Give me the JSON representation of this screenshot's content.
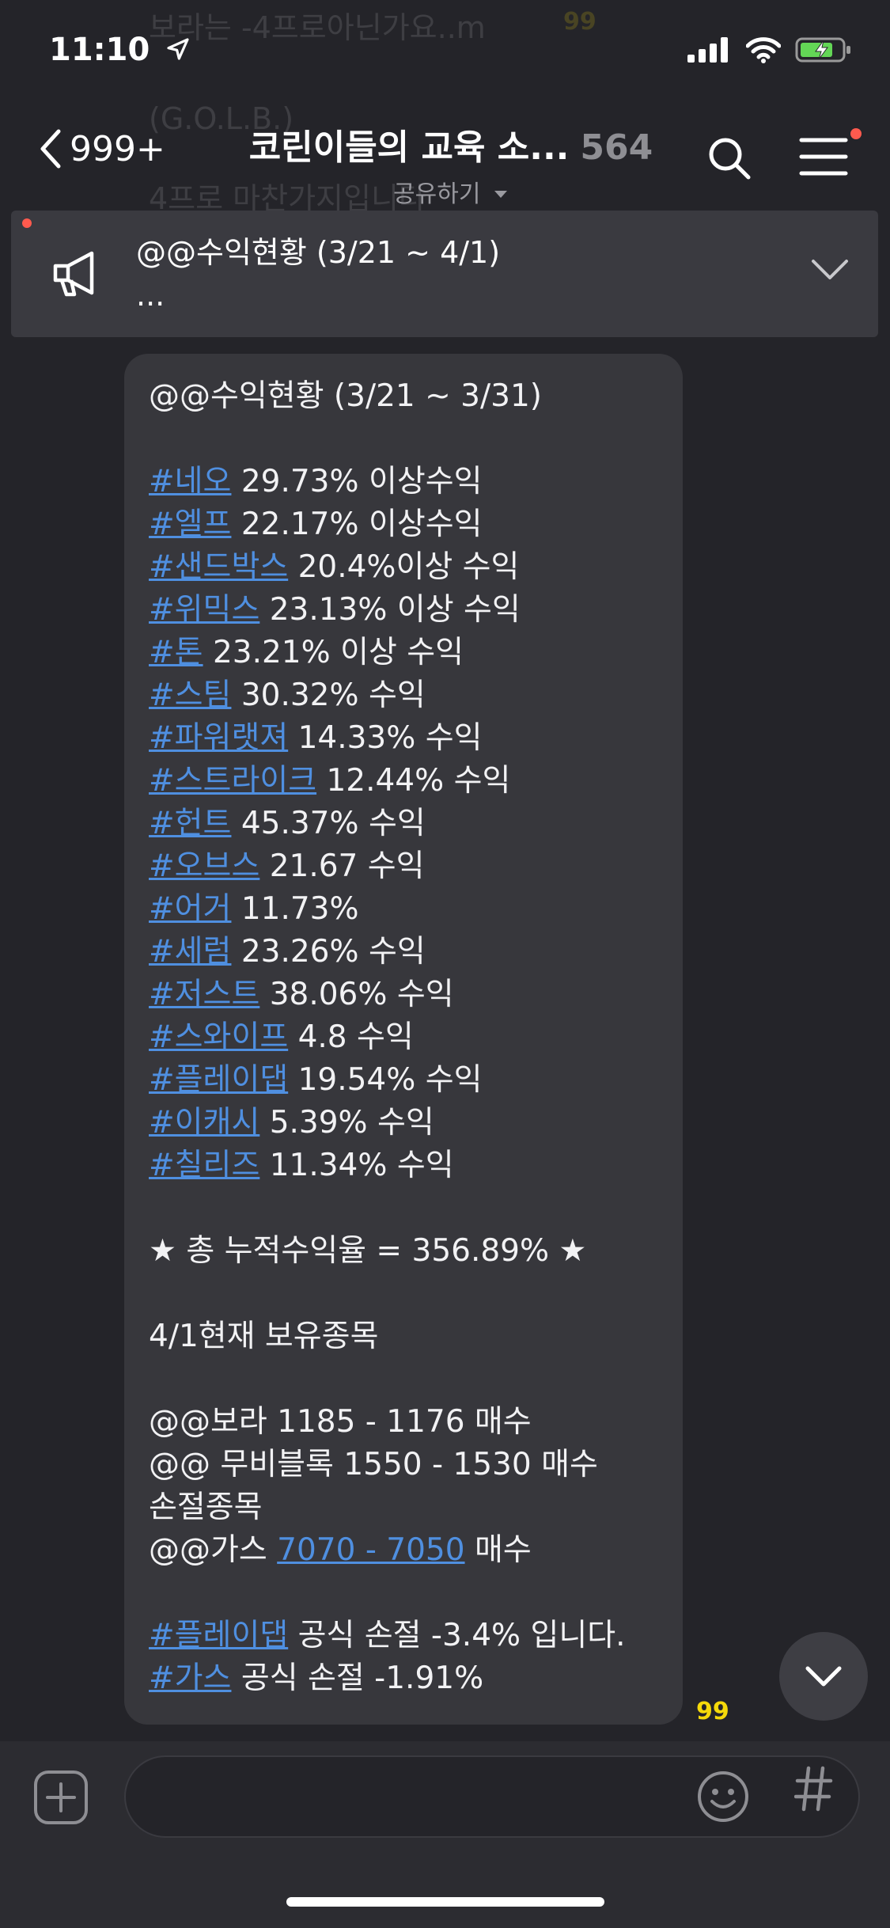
{
  "status_bar": {
    "time": "11:10"
  },
  "background_ghost": {
    "line1": "보라는 -4프로아닌가요..m",
    "line1_count": "99",
    "line2": "(G.O.L.B.)",
    "line3": "4프로 마찬가지입니다"
  },
  "header": {
    "back_count": "999+",
    "title": "코린이들의 교육 소...",
    "member_count": "564",
    "share_label": "공유하기"
  },
  "notice": {
    "title": "@@수익현황 (3/21 ~ 4/1)",
    "more": "..."
  },
  "message": {
    "header": "@@수익현황 (3/21 ~ 3/31)",
    "items": [
      {
        "tag": "#네오",
        "text": " 29.73% 이상수익"
      },
      {
        "tag": "#엘프",
        "text": " 22.17% 이상수익"
      },
      {
        "tag": "#샌드박스",
        "text": " 20.4%이상 수익"
      },
      {
        "tag": "#위믹스",
        "text": " 23.13% 이상 수익"
      },
      {
        "tag": "#톤",
        "text": " 23.21% 이상 수익"
      },
      {
        "tag": "#스팀",
        "text": " 30.32% 수익"
      },
      {
        "tag": "#파워랫져",
        "text": " 14.33% 수익"
      },
      {
        "tag": "#스트라이크",
        "text": " 12.44% 수익"
      },
      {
        "tag": "#헌트",
        "text": " 45.37% 수익"
      },
      {
        "tag": "#오브스",
        "text": " 21.67 수익"
      },
      {
        "tag": "#어거",
        "text": " 11.73%"
      },
      {
        "tag": "#세럼",
        "text": " 23.26% 수익"
      },
      {
        "tag": "#저스트",
        "text": " 38.06% 수익"
      },
      {
        "tag": "#스와이프",
        "text": " 4.8 수익"
      },
      {
        "tag": "#플레이댑",
        "text": " 19.54% 수익"
      },
      {
        "tag": "#이캐시",
        "text": " 5.39% 수익"
      },
      {
        "tag": "#칠리즈",
        "text": " 11.34% 수익"
      }
    ],
    "total": "★ 총 누적수익율 = 356.89% ★",
    "holdings_title": "4/1현재 보유종목",
    "holding1": "@@보라 1185 - 1176 매수",
    "holding2": "@@ 무비블록 1550 - 1530 매수",
    "stoploss_title": "손절종목",
    "gas_prefix": "@@가스 ",
    "gas_link": "7070 - 7050",
    "gas_suffix": " 매수",
    "notice1_tag": "#플레이댑",
    "notice1_text": " 공식 손절 -3.4% 입니다.",
    "notice2_tag": "#가스",
    "notice2_text": " 공식 손절 -1.91%",
    "read_count": "99"
  }
}
